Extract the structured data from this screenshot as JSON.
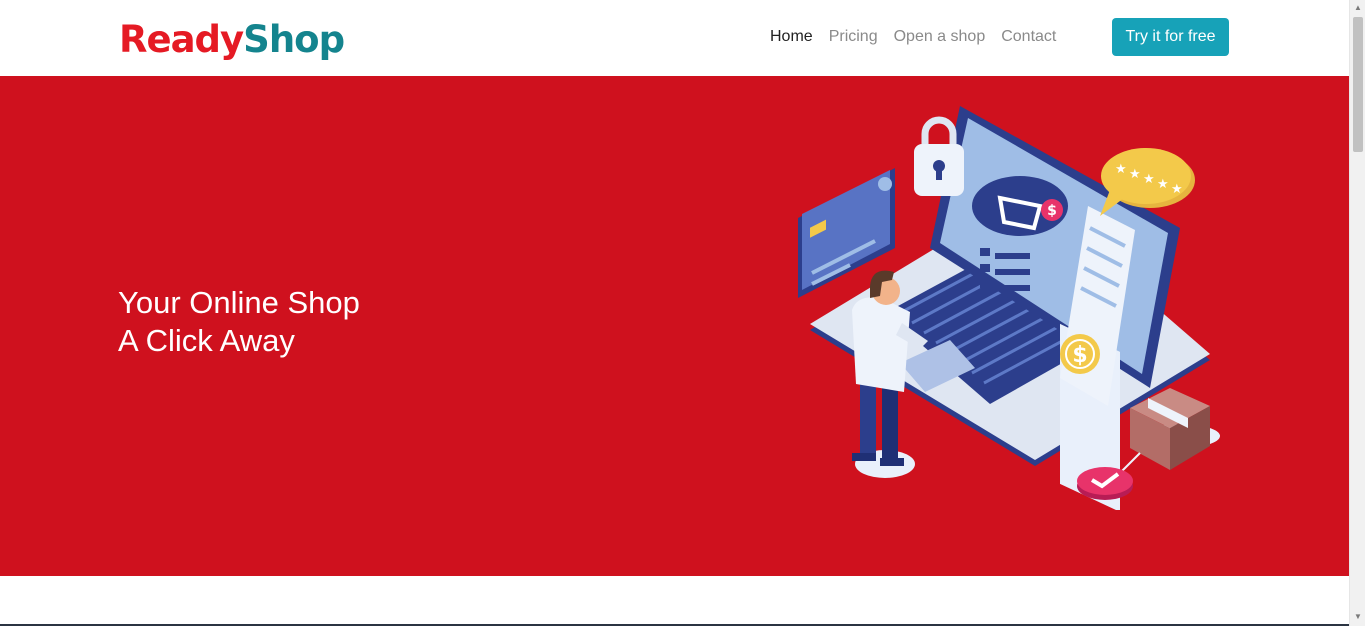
{
  "brand": {
    "part1": "Ready",
    "part2": "Shop"
  },
  "nav": {
    "items": [
      {
        "label": "Home"
      },
      {
        "label": "Pricing"
      },
      {
        "label": "Open a shop"
      },
      {
        "label": "Contact"
      }
    ],
    "cta_label": "Try it for free"
  },
  "hero": {
    "title_line1": "Your Online Shop",
    "title_line2": "A Click Away"
  },
  "colors": {
    "hero_bg": "#cf111e",
    "brand_red": "#e51a24",
    "brand_teal": "#14848e",
    "cta_bg": "#17a2b8"
  },
  "icons": [
    "padlock-icon",
    "credit-card-icon",
    "shopping-basket-icon",
    "dollar-coin-icon",
    "rating-stars-icon",
    "parcel-box-icon",
    "checkmark-badge-icon"
  ]
}
